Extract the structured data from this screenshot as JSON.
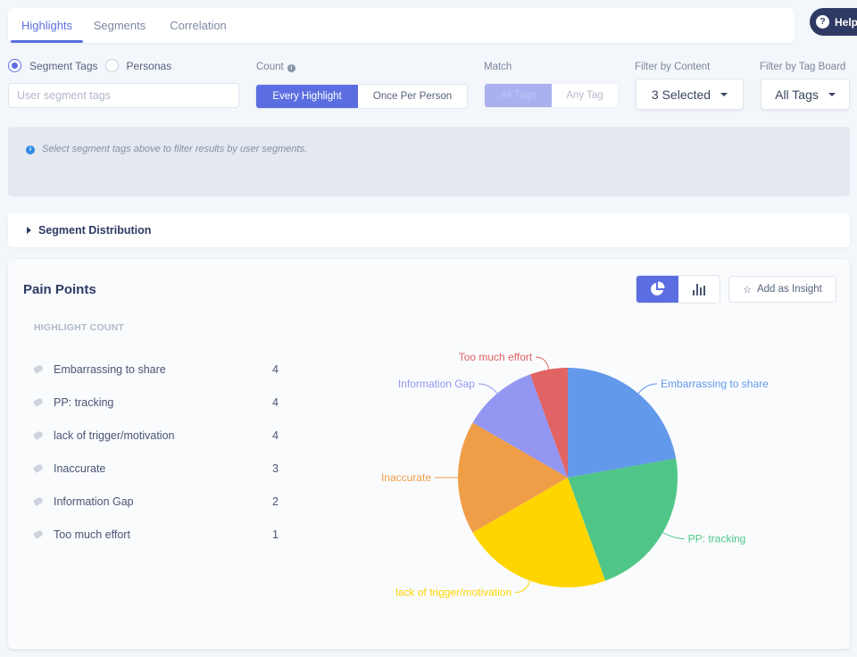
{
  "tabs": [
    {
      "label": "Highlights",
      "active": true
    },
    {
      "label": "Segments",
      "active": false
    },
    {
      "label": "Correlation",
      "active": false
    }
  ],
  "help": {
    "label": "Help",
    "icon": "question-circle-icon"
  },
  "filters": {
    "radio_options": [
      {
        "label": "Segment Tags",
        "checked": true
      },
      {
        "label": "Personas",
        "checked": false
      }
    ],
    "segment_input": {
      "value": "",
      "placeholder": "User segment tags"
    },
    "count": {
      "label": "Count",
      "options": [
        {
          "label": "Every Highlight",
          "active": true
        },
        {
          "label": "Once Per Person",
          "active": false
        }
      ]
    },
    "match": {
      "label": "Match",
      "options": [
        {
          "label": "All Tags",
          "active": true,
          "disabled": true
        },
        {
          "label": "Any Tag",
          "active": false,
          "disabled": true
        }
      ]
    },
    "filter_by_content": {
      "label": "Filter by Content",
      "value": "3 Selected"
    },
    "filter_by_tag_board": {
      "label": "Filter by Tag Board",
      "value": "All Tags"
    }
  },
  "info_message": "Select segment tags above to filter results by user segments.",
  "segment_distribution": {
    "label": "Segment Distribution",
    "expanded": false
  },
  "card": {
    "title": "Pain Points",
    "view_toggle": [
      {
        "icon": "pie-chart-icon",
        "active": true
      },
      {
        "icon": "bar-chart-icon",
        "active": false
      }
    ],
    "add_insight_label": "Add as Insight",
    "count_header": "HIGHLIGHT COUNT",
    "tags": [
      {
        "label": "Embarrassing to share",
        "count": "4"
      },
      {
        "label": "PP: tracking",
        "count": "4"
      },
      {
        "label": "lack of trigger/motivation",
        "count": "4"
      },
      {
        "label": "Inaccurate",
        "count": "3"
      },
      {
        "label": "Information Gap",
        "count": "2"
      },
      {
        "label": "Too much effort",
        "count": "1"
      }
    ]
  },
  "chart_data": {
    "type": "pie",
    "title": "Pain Points",
    "categories": [
      "Embarrassing to share",
      "PP: tracking",
      "lack of trigger/motivation",
      "Inaccurate",
      "Information Gap",
      "Too much effort"
    ],
    "values": [
      4,
      4,
      4,
      3,
      2,
      1
    ],
    "colors": [
      "#6399ea",
      "#4fc687",
      "#ffd500",
      "#f09d47",
      "#9497f1",
      "#e26363"
    ],
    "start": "12 o'clock",
    "direction": "clockwise",
    "labels": "outside with leader lines"
  }
}
